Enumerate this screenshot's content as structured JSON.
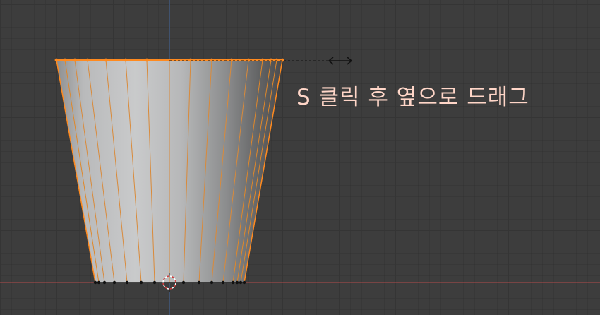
{
  "viewport": {
    "instruction_text": "S 클릭 후 옆으로 드래그"
  },
  "colors": {
    "background": "#3d3d3d",
    "x_axis": "#b34a4a",
    "y_axis": "#4a6fa8",
    "selection": "#ff8a1f",
    "mesh_light": "#c6c7c8",
    "mesh_dark": "#5a5a5c",
    "annotation": "#ffd6c8"
  },
  "icons": {
    "transform_arrow": "double-arrow-horizontal-icon",
    "cursor_3d": "3d-cursor-icon"
  }
}
